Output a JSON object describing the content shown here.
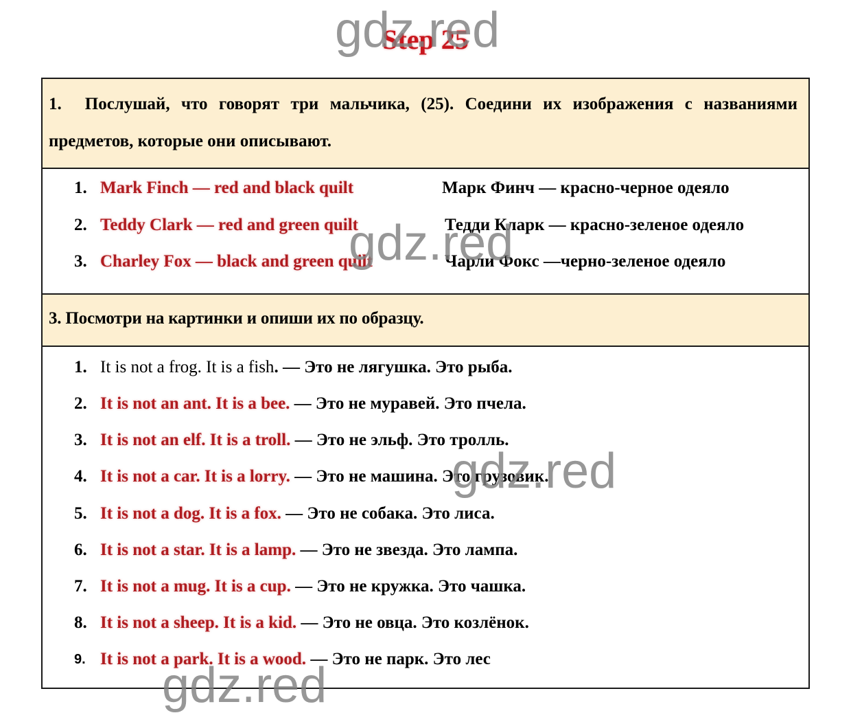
{
  "page": {
    "title": "Step 25",
    "watermark": "gdz.red"
  },
  "colors": {
    "answer_red": "#b01c20",
    "title_red": "#c8161d",
    "band_bg": "#fdefd1",
    "border": "#1a1a1a"
  },
  "task1": {
    "number": "1.",
    "instruction": "Послушай, что говорят три мальчика, (25). Соедини их изображения с названиями предметов, которые они описывают.",
    "answers": [
      {
        "num": "1.",
        "en": "Mark Finch — red and black quilt",
        "ru": "Марк Финч — красно-черное одеяло"
      },
      {
        "num": "2.",
        "en": "Teddy Clark — red and green quilt",
        "ru": "Тедди Кларк — красно-зеленое одеяло"
      },
      {
        "num": "3.",
        "en": "Charley Fox — black and green quilt",
        "ru": "Чарли Фокс —черно-зеленое одеяло"
      }
    ]
  },
  "task3": {
    "instruction": "3. Посмотри на картинки и опиши их по образцу.",
    "answers": [
      {
        "num": "1.",
        "en": "It is not a frog. It is a fish",
        "sep": ". — ",
        "ru": "Это не лягушка. Это рыба.",
        "sample": true
      },
      {
        "num": "2.",
        "en": "It is not an ant. It is a bee.",
        "sep": " — ",
        "ru": "Это не муравей. Это пчела."
      },
      {
        "num": "3.",
        "en": "It is not an elf. It is a troll.",
        "sep": " — ",
        "ru": "Это не эльф. Это тролль."
      },
      {
        "num": "4.",
        "en": "It is not a car. It is a lorry.",
        "sep": " — ",
        "ru": "Это не машина. Это грузовик."
      },
      {
        "num": "5.",
        "en": "It is not a dog. It is a fox.",
        "sep": " — ",
        "ru": "Это не собака. Это лиса."
      },
      {
        "num": "6.",
        "en": "It is not a star. It is a lamp.",
        "sep": " — ",
        "ru": "Это не звезда. Это лампа."
      },
      {
        "num": "7.",
        "en": "It is not a mug. It is a cup.",
        "sep": " — ",
        "ru": "Это не кружка. Это чашка."
      },
      {
        "num": "8.",
        "en": "It is not a sheep. It is a kid.",
        "sep": " — ",
        "ru": "Это не овца. Это козлёнок."
      },
      {
        "num": "9.",
        "en": "It is not a park. It is a wood.",
        "sep": " — ",
        "ru": "Это не парк. Это лес"
      }
    ]
  }
}
